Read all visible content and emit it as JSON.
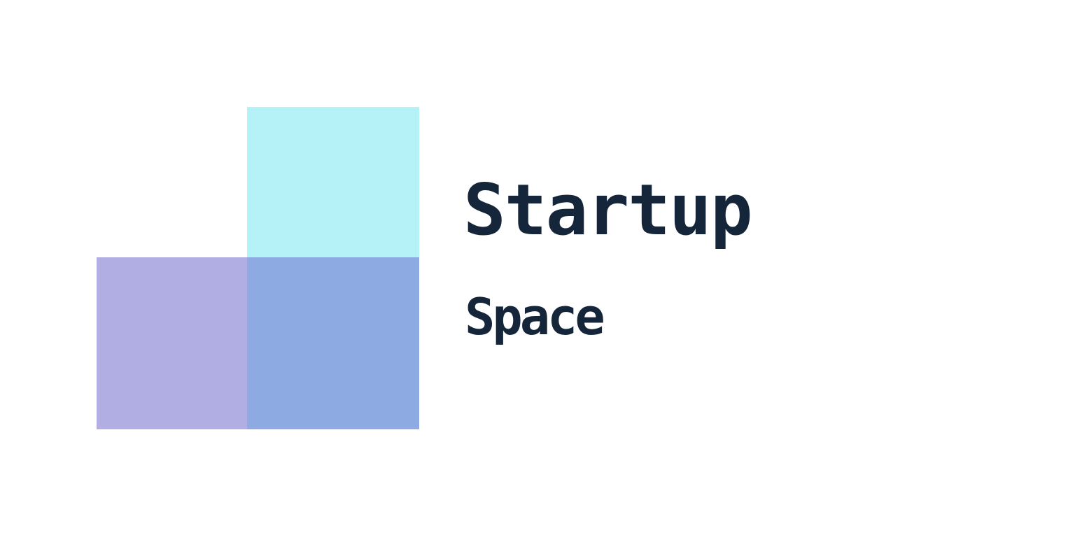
{
  "logo": {
    "primary_word": "Startup",
    "secondary_word": "Space",
    "colors": {
      "top_square": "#b5f2f8",
      "left_square": "#b1aee4",
      "overlap_square": "#8eaae3",
      "text": "#15263a",
      "background": "#ffffff"
    }
  }
}
